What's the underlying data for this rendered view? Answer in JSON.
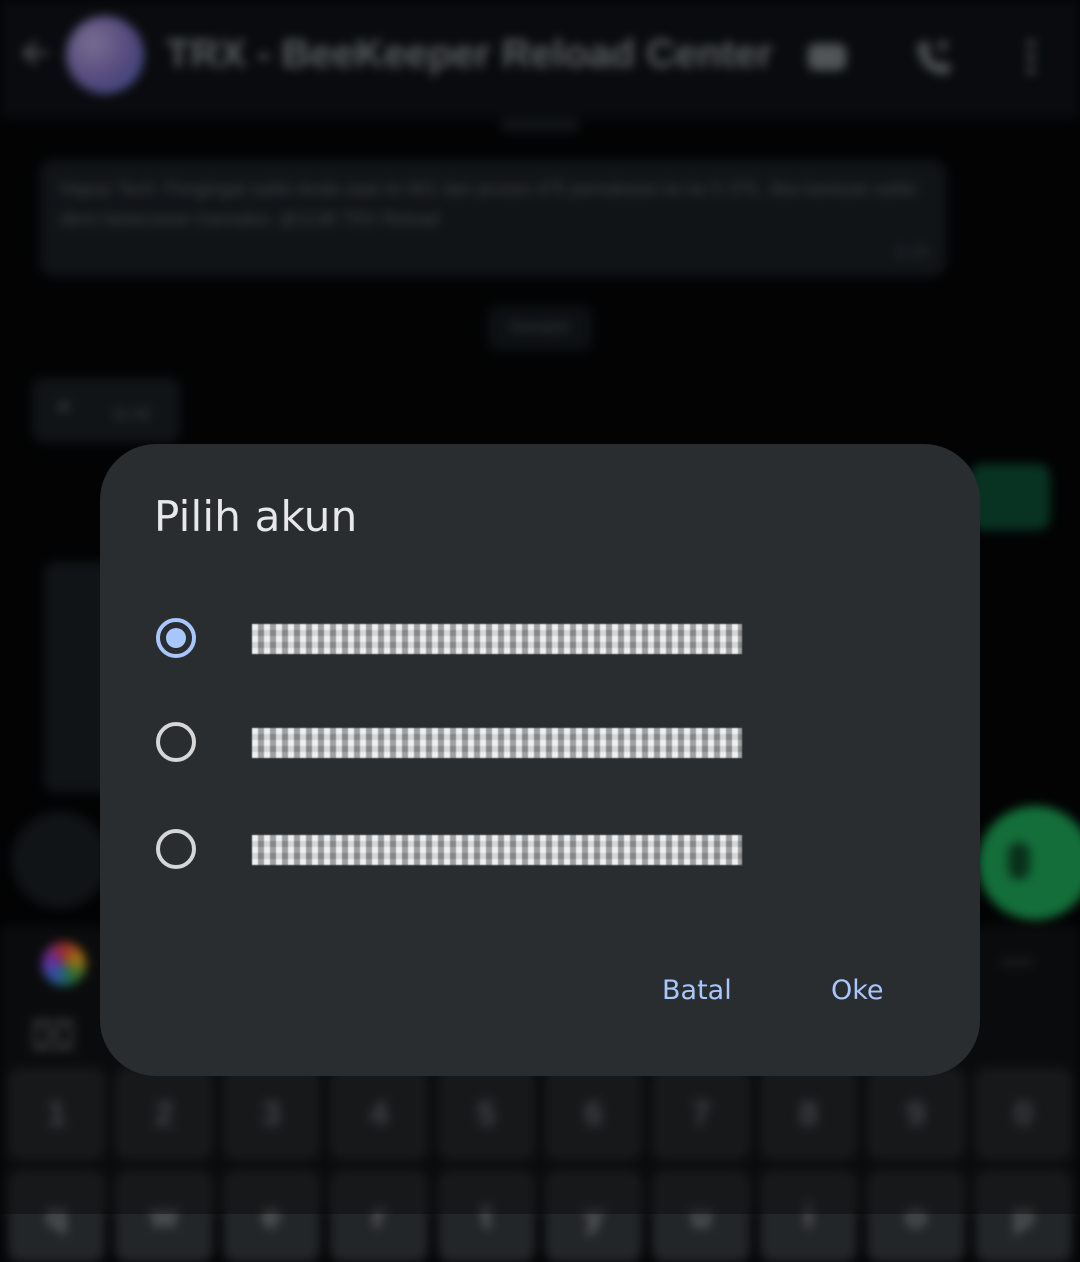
{
  "background_app": {
    "chat_title": "TRX - BeeKeeper Reload Center",
    "message_text": "Hapus Tech: Pengingat saldo Anda saat ini 401 dan proses 475 pemakaian ke ke 5 375. Jika bantuan saldo demi kelancaran transaksi. @1138 TRX Reload",
    "message_time": "11.28",
    "day_label": "Kemarin",
    "left_bubble_text": "11.42",
    "keyboard_number_row": [
      "1",
      "2",
      "3",
      "4",
      "5",
      "6",
      "7",
      "8",
      "9",
      "0"
    ],
    "keyboard_letter_row": [
      "q",
      "w",
      "e",
      "r",
      "t",
      "y",
      "u",
      "i",
      "o",
      "p"
    ]
  },
  "dialog": {
    "title": "Pilih akun",
    "options": [
      {
        "label": "account-one-redacted",
        "selected": true
      },
      {
        "label": "account-two-redacted",
        "selected": false
      },
      {
        "label": "account-three-redacted",
        "selected": false
      }
    ],
    "cancel_label": "Batal",
    "ok_label": "Oke"
  },
  "colors": {
    "dialog_bg": "#2a2d30",
    "accent": "#a9c7ff",
    "title_text": "#e6e8ea",
    "green_fab": "#1faa59"
  }
}
